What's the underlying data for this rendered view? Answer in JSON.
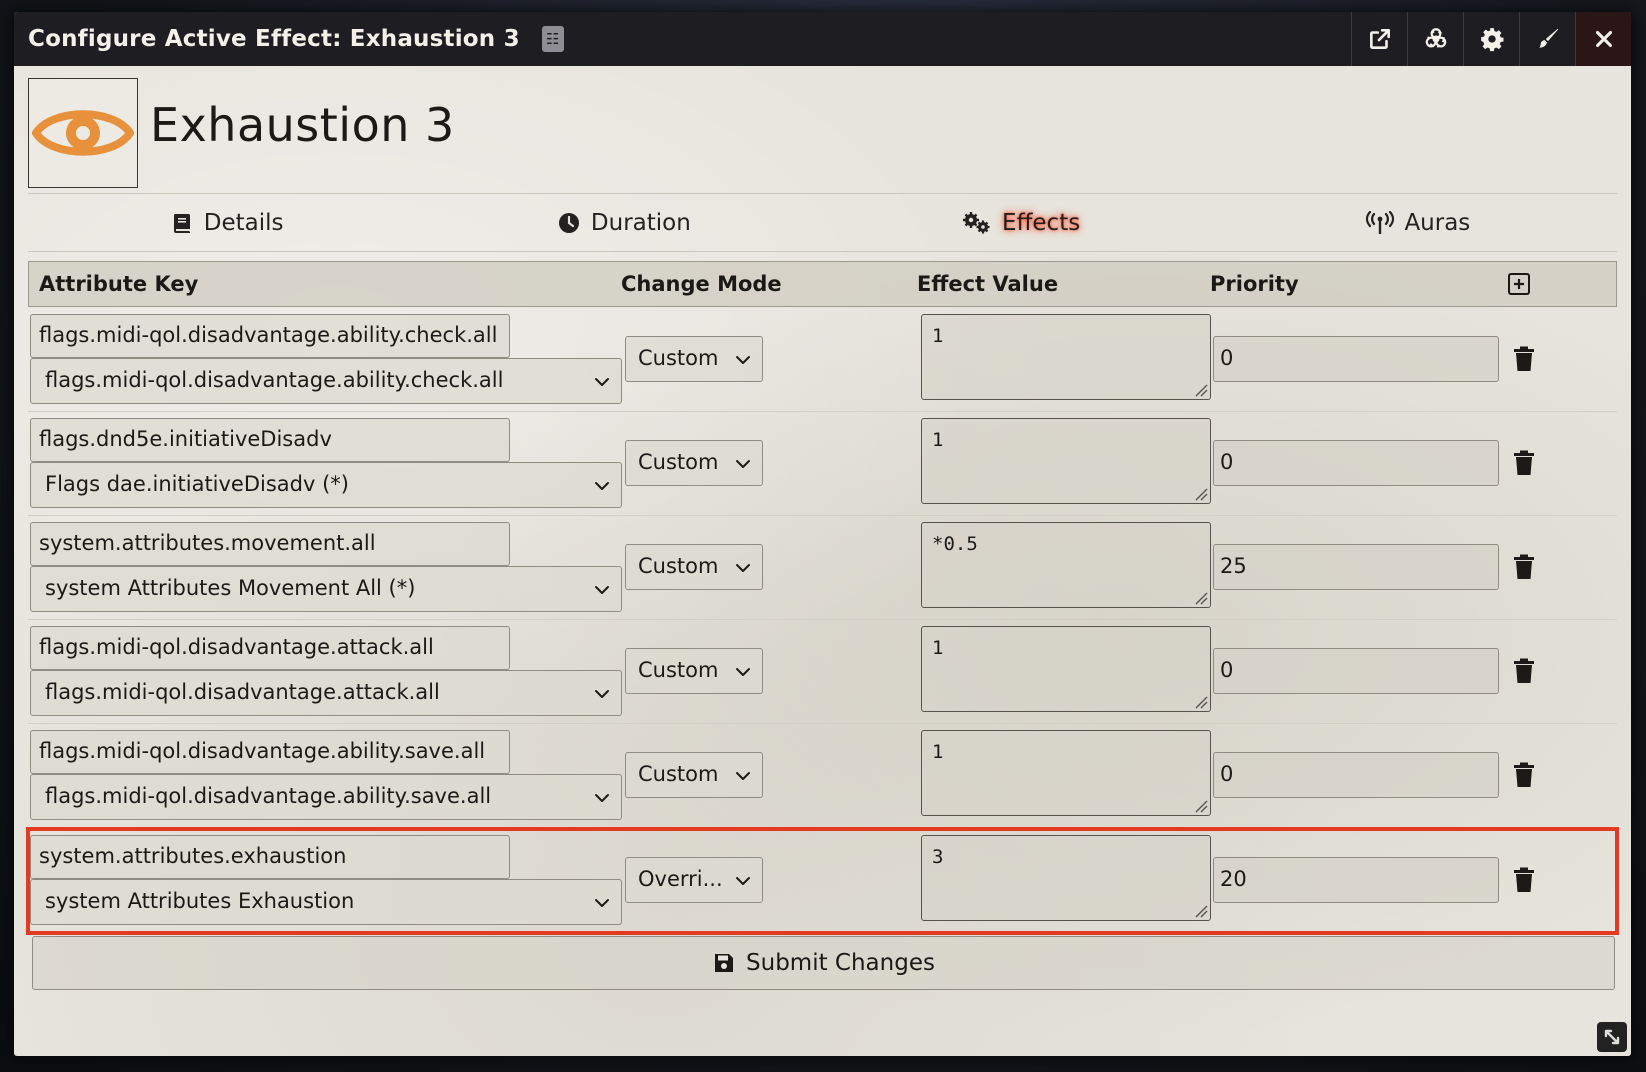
{
  "window": {
    "title": "Configure Active Effect: Exhaustion 3",
    "header_buttons": [
      "external-link-icon",
      "biohazard-icon",
      "gear-icon",
      "brush-icon",
      "close-icon"
    ]
  },
  "effect": {
    "name": "Exhaustion 3",
    "icon": "eye-icon",
    "icon_color": "#e8913c"
  },
  "tabs": [
    {
      "label": "Details",
      "icon": "book-icon",
      "active": false
    },
    {
      "label": "Duration",
      "icon": "clock-icon",
      "active": false
    },
    {
      "label": "Effects",
      "icon": "cogs-icon",
      "active": true
    },
    {
      "label": "Auras",
      "icon": "broadcast-icon",
      "active": false
    }
  ],
  "table": {
    "headers": {
      "key": "Attribute Key",
      "mode": "Change Mode",
      "value": "Effect Value",
      "priority": "Priority"
    },
    "rows": [
      {
        "key": "flags.midi-qol.disadvantage.ability.check.all",
        "key_select": "flags.midi-qol.disadvantage.ability.check.all",
        "mode": "Custom",
        "value": "1",
        "priority": "0"
      },
      {
        "key": "flags.dnd5e.initiativeDisadv",
        "key_select": "Flags dae.initiativeDisadv (*)",
        "mode": "Custom",
        "value": "1",
        "priority": "0"
      },
      {
        "key": "system.attributes.movement.all",
        "key_select": "system Attributes Movement All (*)",
        "mode": "Custom",
        "value": "*0.5",
        "priority": "25"
      },
      {
        "key": "flags.midi-qol.disadvantage.attack.all",
        "key_select": "flags.midi-qol.disadvantage.attack.all",
        "mode": "Custom",
        "value": "1",
        "priority": "0"
      },
      {
        "key": "flags.midi-qol.disadvantage.ability.save.all",
        "key_select": "flags.midi-qol.disadvantage.ability.save.all",
        "mode": "Custom",
        "value": "1",
        "priority": "0"
      },
      {
        "key": "system.attributes.exhaustion",
        "key_select": "system Attributes Exhaustion",
        "mode": "Overri...",
        "value": "3",
        "priority": "20"
      }
    ]
  },
  "submit": {
    "label": "Submit Changes"
  },
  "colors": {
    "highlight": "#e23b22",
    "active_tab_glow": "#ff3a1a",
    "titlebar": "#1e1e22"
  }
}
